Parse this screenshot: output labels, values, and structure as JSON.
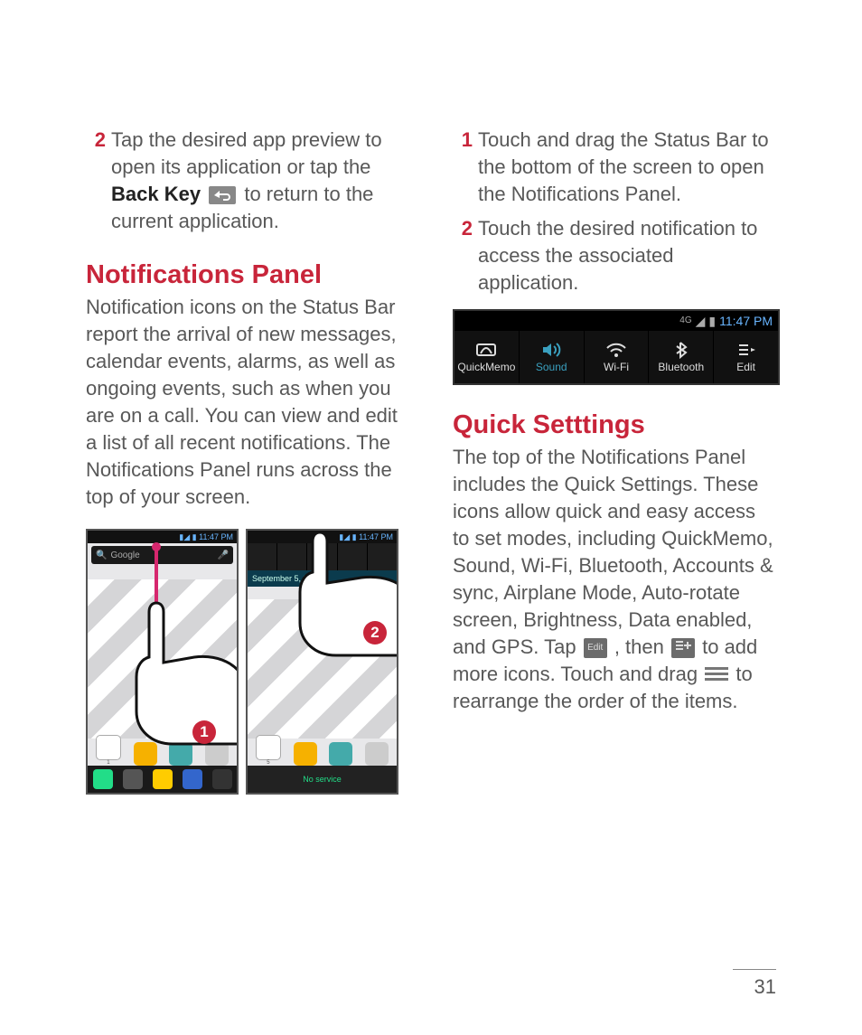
{
  "page_number": "31",
  "left": {
    "step2": {
      "num": "2",
      "a": "Tap the desired app preview to open its application or tap the ",
      "bold": "Back Key",
      "b": " to return to the current application."
    },
    "h2": "Notifications Panel",
    "para": "Notification icons on the Status Bar report the arrival of new messages, calendar events, alarms, as well as ongoing events, such as when you are on a call. You can view and edit a list of all recent notifications. The Notifications Panel runs across the top of your screen.",
    "shot_time": "11:47 PM",
    "shot_search": "Google",
    "shot_date": "September 5, 2012",
    "shot_noservice": "No service",
    "callout1": "1",
    "callout2": "2"
  },
  "right": {
    "step1": {
      "num": "1",
      "text": "Touch and drag the Status Bar to the bottom of the screen to open the Notifications Panel."
    },
    "step2": {
      "num": "2",
      "text": "Touch the desired notification to access the associated application."
    },
    "qs_time": "11:47 PM",
    "qs_items": [
      {
        "label": "QuickMemo",
        "icon": "memo",
        "active": false
      },
      {
        "label": "Sound",
        "icon": "sound",
        "active": true
      },
      {
        "label": "Wi-Fi",
        "icon": "wifi",
        "active": false
      },
      {
        "label": "Bluetooth",
        "icon": "bt",
        "active": false
      },
      {
        "label": "Edit",
        "icon": "edit",
        "active": false
      }
    ],
    "h2": "Quick Setttings",
    "qpara_a": "The top of the Notifications Panel includes the Quick Settings. These icons allow quick and easy access to set modes, including QuickMemo, Sound, Wi-Fi, Bluetooth, Accounts & sync, Airplane Mode, Auto-rotate screen, Brightness, Data enabled, and GPS. Tap ",
    "edit_label": "Edit",
    "qpara_b": ", then ",
    "qpara_c": " to add more icons. Touch and drag ",
    "qpara_d": " to rearrange the order of the items."
  }
}
